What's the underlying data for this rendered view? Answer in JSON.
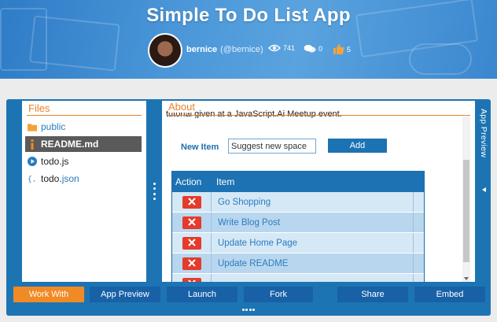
{
  "header": {
    "title": "Simple To Do List App",
    "user_name": "bernice",
    "user_handle": "(@bernice)",
    "views": "741",
    "comments": "0",
    "likes": "5"
  },
  "files": {
    "title": "Files",
    "items": [
      {
        "name": "public",
        "ext": "",
        "icon": "folder-icon"
      },
      {
        "name": "README.md",
        "ext": "",
        "icon": "info-icon"
      },
      {
        "name": "todo.js",
        "ext": "",
        "icon": "play-icon"
      },
      {
        "name": "todo.",
        "ext": "json",
        "icon": "braces-icon"
      }
    ],
    "active_index": 1
  },
  "about": {
    "title": "About",
    "partial_text": "tutorial given at a JavaScript.Ai Meetup event.",
    "new_item_label": "New Item",
    "new_item_value": "Suggest new space",
    "add_label": "Add",
    "table": {
      "headers": [
        "Action",
        "Item"
      ],
      "rows": [
        "Go Shopping",
        "Write Blog Post",
        "Update Home Page",
        "Update README",
        ""
      ]
    }
  },
  "preview_tab": {
    "label": "App Preview"
  },
  "toolbar": {
    "work_with": "Work With",
    "app_preview": "App Preview",
    "launch": "Launch",
    "fork": "Fork",
    "share": "Share",
    "embed": "Embed"
  },
  "colors": {
    "brand_blue": "#1d74b3",
    "accent_orange": "#f08a24",
    "delete_red": "#e43b2c"
  }
}
